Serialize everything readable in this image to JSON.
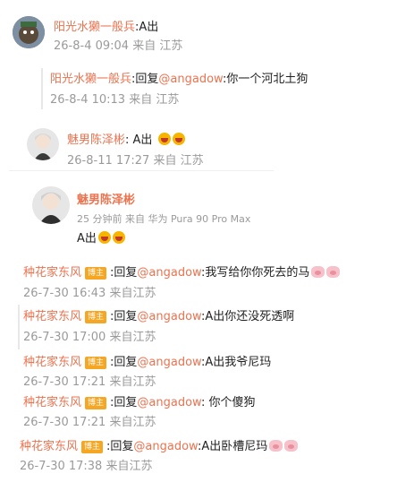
{
  "comments": [
    {
      "user": "阳光水獭一般兵",
      "text": ":A出",
      "time": "26-8-4 09:04",
      "location": "来自 江苏",
      "replies": [
        {
          "user": "阳光水獭一般兵",
          "prefix": ":回复",
          "mention": "@angadow",
          "text": ":你一个河北土狗",
          "time": "26-8-4 10:13",
          "location": "来自 江苏"
        }
      ]
    },
    {
      "user": "魅男陈泽彬",
      "text": ": A出",
      "time": "26-8-11 17:27",
      "location": "来自 江苏",
      "emoji": [
        "laugh-emoji",
        "laugh-emoji"
      ]
    }
  ],
  "post": {
    "user": "魅男陈泽彬",
    "meta": "25 分钟前  来自 华为 Pura 90 Pro Max",
    "text": "A出",
    "emoji": [
      "laugh-emoji",
      "laugh-emoji"
    ]
  },
  "replies": [
    {
      "user": "种花家东风",
      "badge": "博主",
      "prefix": ":回复",
      "mention": "@angadow",
      "text": ":我写给你你死去的马",
      "time": "26-7-30 16:43",
      "location": "来自江苏",
      "emoji": [
        "pig-emoji",
        "pig-emoji"
      ]
    },
    {
      "user": "种花家东风",
      "badge": "博主",
      "prefix": ":回复",
      "mention": "@angadow",
      "text": ":A出你还没死透啊",
      "time": "26-7-30 17:00",
      "location": "来自江苏"
    },
    {
      "user": "种花家东风",
      "badge": "博主",
      "prefix": ":回复",
      "mention": "@angadow",
      "text": ":A出我爷尼玛",
      "time": "26-7-30 17:21",
      "location": "来自江苏"
    },
    {
      "user": "种花家东风",
      "badge": "博主",
      "prefix": ":回复",
      "mention": "@angadow",
      "text": ": 你个傻狗",
      "time": "26-7-30 17:21",
      "location": "来自江苏"
    },
    {
      "user": "种花家东风",
      "badge": "博主",
      "prefix": ":回复",
      "mention": "@angadow",
      "text": ":A出卧槽尼玛",
      "time": "26-7-30 17:38",
      "location": "来自江苏",
      "emoji": [
        "pig-emoji",
        "pig-emoji"
      ]
    }
  ],
  "colors": {
    "name": "#eb7350",
    "meta": "#9a9a9a",
    "badge": "#f5a623"
  }
}
